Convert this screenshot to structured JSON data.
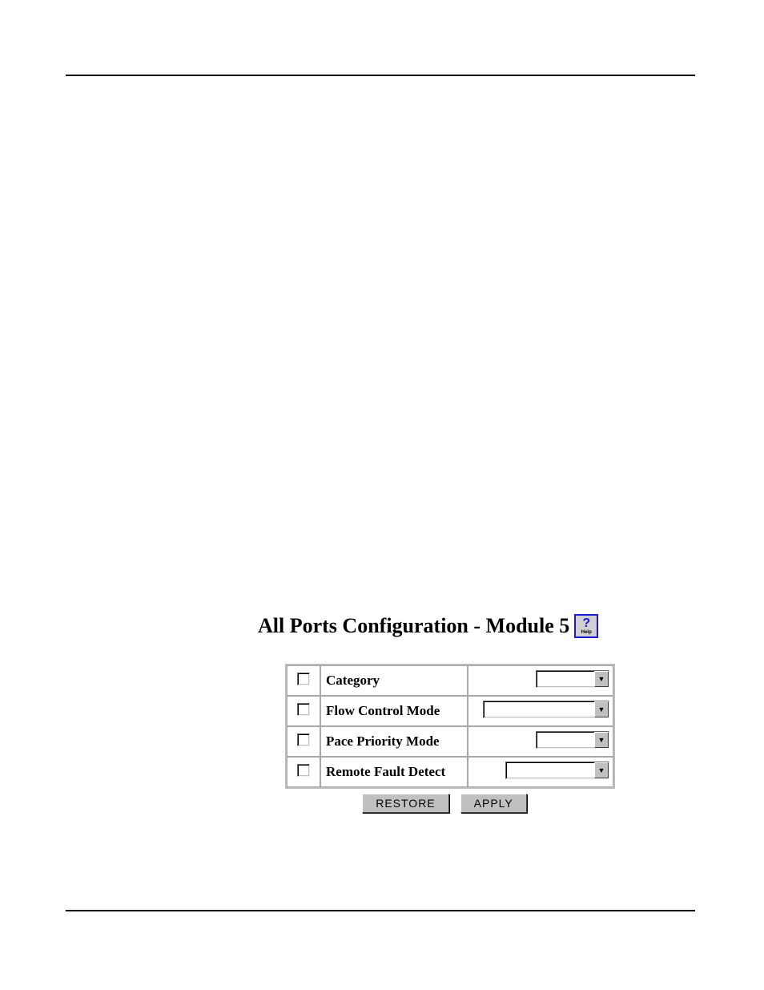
{
  "title": "All Ports Configuration - Module 5",
  "help_label": "Help",
  "rows": [
    {
      "label": "Category"
    },
    {
      "label": "Flow Control Mode"
    },
    {
      "label": "Pace Priority Mode"
    },
    {
      "label": "Remote Fault Detect"
    }
  ],
  "buttons": {
    "restore": "RESTORE",
    "apply": "APPLY"
  }
}
